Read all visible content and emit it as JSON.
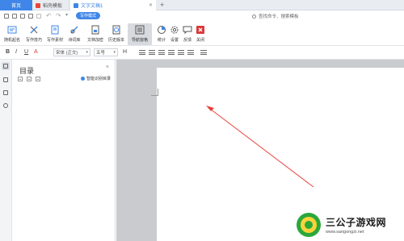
{
  "tabs": [
    {
      "label": "首页",
      "active": false
    },
    {
      "label": "稻壳模板",
      "active": false
    },
    {
      "label": "文字文稿1",
      "active": true
    }
  ],
  "quickbar": {
    "mode_label": "写作模式",
    "search_placeholder": "查找命令、搜索模板"
  },
  "ribbon": {
    "buttons": [
      {
        "label": "随机起名",
        "icon": "name-icon"
      },
      {
        "label": "写作技巧",
        "icon": "pen-icon"
      },
      {
        "label": "写作素材",
        "icon": "material-icon"
      },
      {
        "label": "诗词库",
        "icon": "poem-icon"
      },
      {
        "label": "文档加密",
        "icon": "lock-doc-icon"
      },
      {
        "label": "历史版本",
        "icon": "history-icon"
      },
      {
        "label": "导航窗格",
        "icon": "nav-pane-icon"
      },
      {
        "label": "统计",
        "icon": "stats-icon"
      },
      {
        "label": "设置",
        "icon": "gear-icon"
      },
      {
        "label": "反馈",
        "icon": "feedback-icon"
      },
      {
        "label": "关闭",
        "icon": "close-icon"
      }
    ],
    "close_color": "#d93a3a",
    "accent_color": "#3f86e8"
  },
  "format": {
    "bold": "B",
    "italic": "I",
    "underline": "U",
    "font_color": "A",
    "font_family": "宋体 (正文)",
    "font_size": "五号",
    "heading": "H"
  },
  "toc": {
    "title": "目录",
    "close": "×",
    "smart_label": "智能识别目录"
  },
  "watermark": {
    "name": "三公子游戏网",
    "url": "www.sangongzi.net"
  }
}
